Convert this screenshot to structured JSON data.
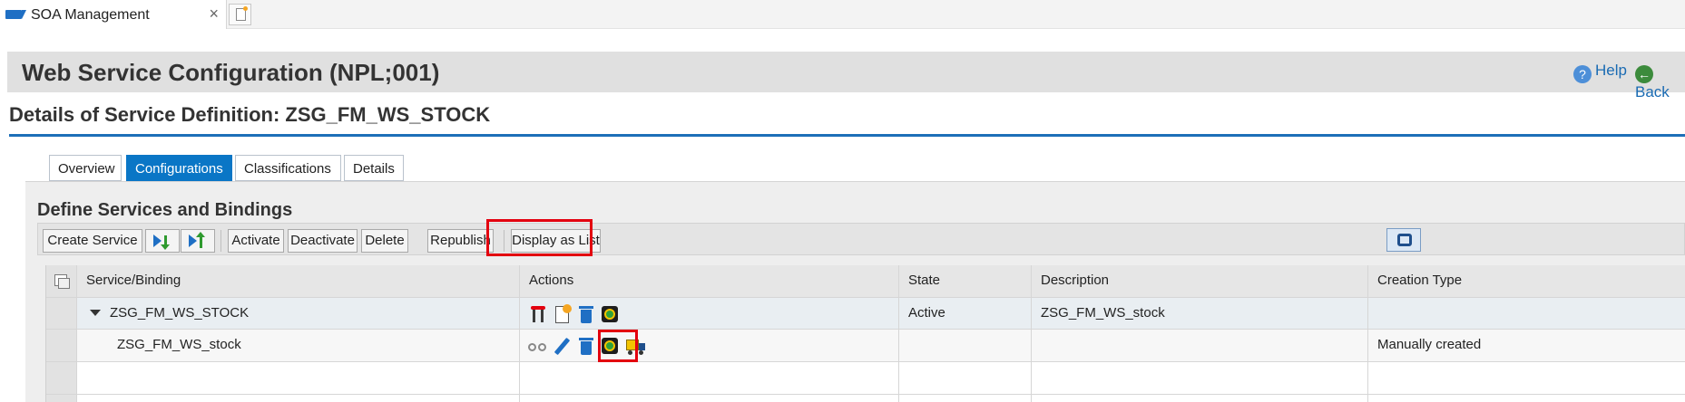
{
  "browser": {
    "tab_title": "SOA Management",
    "close_glyph": "×"
  },
  "header": {
    "title": "Web Service Configuration (NPL;001)",
    "help_label": "Help",
    "back_label": "Back"
  },
  "page": {
    "heading": "Details of Service Definition: ZSG_FM_WS_STOCK"
  },
  "tabs": [
    {
      "label": "Overview",
      "active": false
    },
    {
      "label": "Configurations",
      "active": true
    },
    {
      "label": "Classifications",
      "active": false
    },
    {
      "label": "Details",
      "active": false
    }
  ],
  "section": {
    "title": "Define Services and Bindings"
  },
  "toolbar": {
    "create_service": "Create Service",
    "activate": "Activate",
    "deactivate": "Deactivate",
    "delete": "Delete",
    "republish": "Republish",
    "display_as_list": "Display as List"
  },
  "table": {
    "columns": [
      "Service/Binding",
      "Actions",
      "State",
      "Description",
      "Creation Type"
    ],
    "rows": [
      {
        "service_binding": "ZSG_FM_WS_STOCK",
        "expanded": true,
        "actions": [
          "create-binding-icon",
          "new-document-icon",
          "delete-icon",
          "publish-globe-icon"
        ],
        "state": "Active",
        "description": "ZSG_FM_WS_stock",
        "creation_type": ""
      },
      {
        "service_binding": "ZSG_FM_WS_stock",
        "actions": [
          "display-glasses-icon",
          "edit-pencil-icon",
          "delete-icon",
          "publish-globe-icon",
          "transport-truck-icon"
        ],
        "state": "",
        "description": "",
        "creation_type": "Manually created"
      }
    ]
  },
  "colors": {
    "accent": "#0a76c6",
    "highlight": "#e3000f"
  }
}
